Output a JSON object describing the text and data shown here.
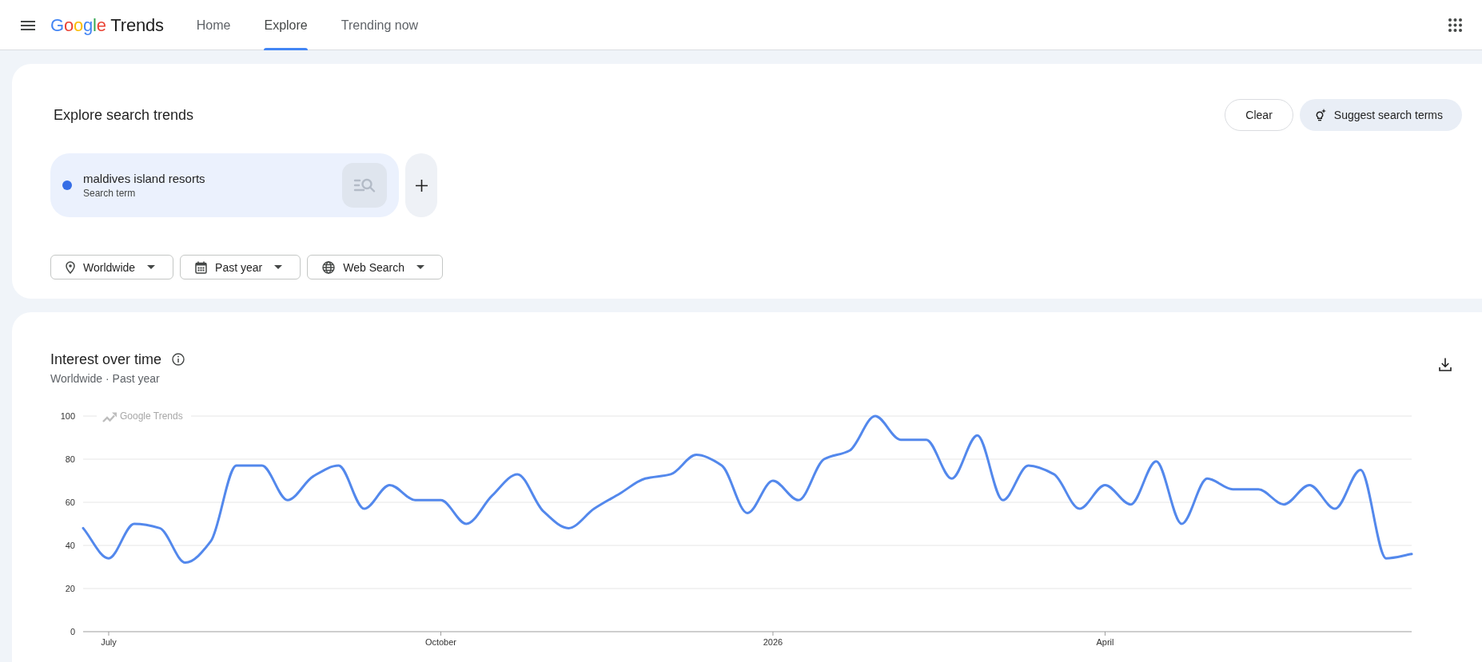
{
  "header": {
    "logo": {
      "brand": "Google",
      "product": "Trends"
    },
    "tabs": [
      {
        "label": "Home",
        "selected": false
      },
      {
        "label": "Explore",
        "selected": true
      },
      {
        "label": "Trending now",
        "selected": false
      }
    ]
  },
  "explore": {
    "title": "Explore search trends",
    "actions": [
      {
        "label": "Clear",
        "kind": "clear"
      },
      {
        "label": "Suggest search terms",
        "kind": "suggest"
      }
    ],
    "terms": [
      {
        "term": "maldives island resorts",
        "type": "Search term",
        "color": "#356de6"
      }
    ],
    "filters": [
      {
        "label": "Worldwide",
        "kind": "location"
      },
      {
        "label": "Past year",
        "kind": "date"
      },
      {
        "label": "Web Search",
        "kind": "search_type"
      }
    ]
  },
  "interest": {
    "title": "Interest over time",
    "subtitle": "Worldwide · Past year",
    "chart_brand": "Google Trends",
    "chart_data": {
      "type": "line",
      "categories": [
        null,
        "July",
        null,
        null,
        null,
        null,
        null,
        null,
        null,
        null,
        null,
        null,
        null,
        null,
        "October",
        null,
        null,
        null,
        null,
        null,
        null,
        null,
        null,
        null,
        null,
        null,
        null,
        "2026",
        null,
        null,
        null,
        null,
        null,
        null,
        null,
        null,
        null,
        null,
        null,
        null,
        "April",
        null,
        null,
        null,
        null,
        null,
        null,
        null,
        null,
        null,
        null,
        null,
        null
      ],
      "series": [
        {
          "color": "#5388ec",
          "values": [
            48,
            34,
            50,
            48,
            32,
            42,
            77,
            77,
            61,
            72,
            77,
            57,
            68,
            61,
            61,
            50,
            63,
            73,
            56,
            48,
            57,
            64,
            71,
            73,
            82,
            77,
            55,
            70,
            61,
            80,
            84,
            100,
            89,
            89,
            71,
            91,
            61,
            77,
            73,
            57,
            68,
            59,
            79,
            50,
            71,
            66,
            66,
            59,
            68,
            57,
            75,
            34,
            36
          ]
        }
      ],
      "ylim": [
        0,
        100
      ],
      "yticks": [
        0,
        20,
        40,
        60,
        80,
        100
      ],
      "grid": true
    }
  }
}
